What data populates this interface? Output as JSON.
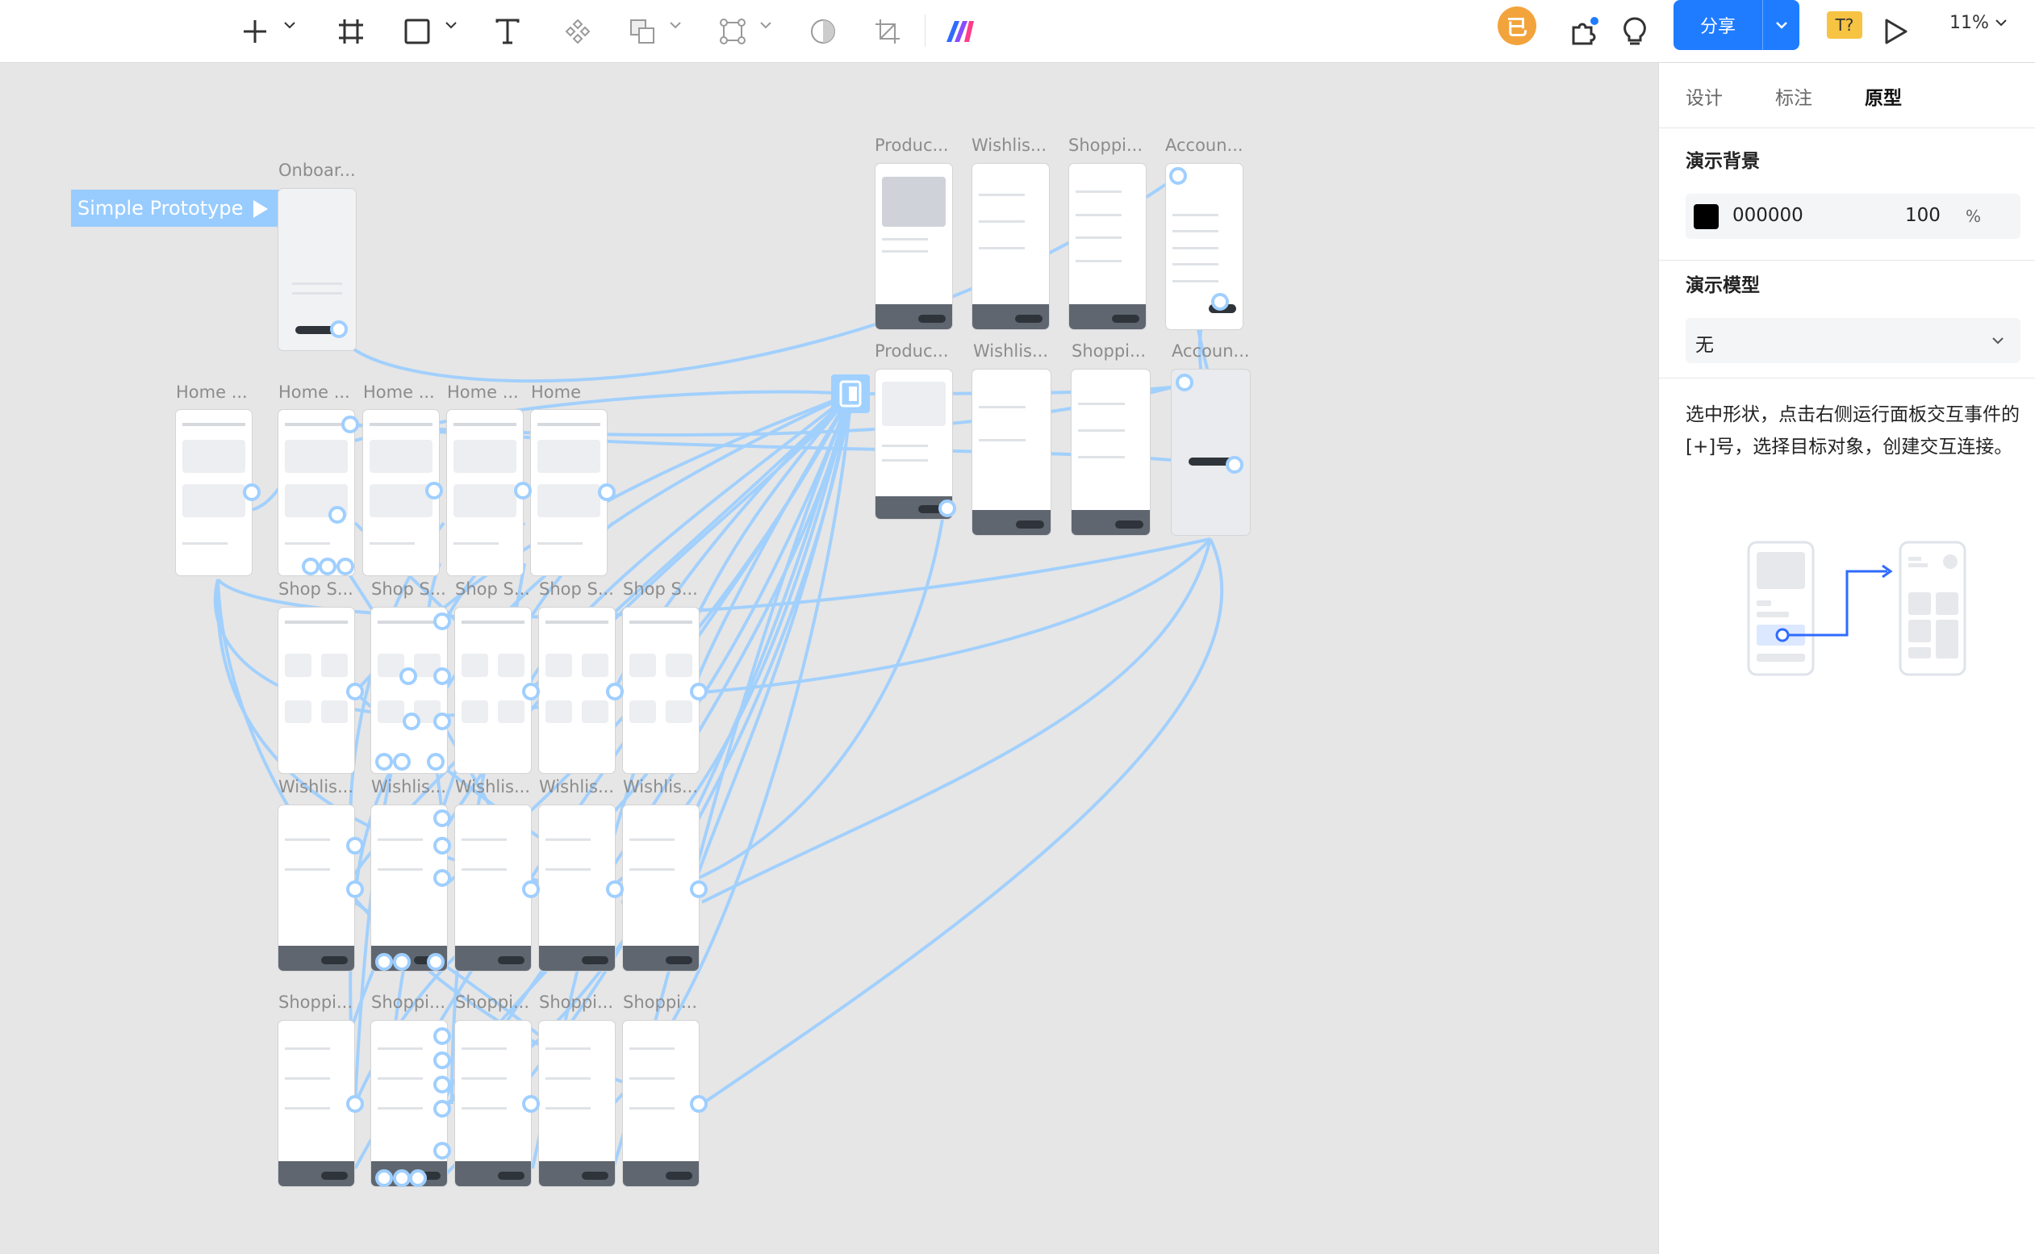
{
  "toolbar": {
    "avatar_text": "已",
    "share_label": "分享",
    "font_badge": "T?",
    "zoom": "11%",
    "icons": [
      "add-icon",
      "frame-icon",
      "rectangle-icon",
      "text-icon",
      "component-move-icon",
      "boolean-icon",
      "vector-points-icon",
      "mask-icon",
      "crop-icon",
      "ai-plugin-icon",
      "plugin-icon",
      "bulb-icon",
      "play-icon"
    ]
  },
  "canvas": {
    "flow_label": "Simple Prototype",
    "frames": {
      "onboarding": "Onboar...",
      "row1": [
        "Produc...",
        "Wishlis...",
        "Shoppi...",
        "Accoun..."
      ],
      "row2": [
        "Produc...",
        "Wishlis...",
        "Shoppi...",
        "Accoun..."
      ],
      "home": [
        "Home ...",
        "Home ...",
        "Home ...",
        "Home ...",
        "Home"
      ],
      "shop": [
        "Shop S...",
        "Shop S...",
        "Shop S...",
        "Shop S...",
        "Shop S..."
      ],
      "wishlist": [
        "Wishlis...",
        "Wishlis...",
        "Wishlis...",
        "Wishlis...",
        "Wishlis..."
      ],
      "shopping": [
        "Shoppi...",
        "Shoppi...",
        "Shoppi...",
        "Shoppi...",
        "Shoppi..."
      ]
    },
    "link_color": "#9fcfff"
  },
  "panel": {
    "tabs": [
      "设计",
      "标注",
      "原型"
    ],
    "active_tab": "原型",
    "bg_title": "演示背景",
    "bg_color": "000000",
    "bg_opacity": "100",
    "bg_unit": "%",
    "model_title": "演示模型",
    "model_value": "无",
    "help_text": "选中形状，点击右侧运行面板交互事件的[+]号，选择目标对象，创建交互连接。"
  }
}
